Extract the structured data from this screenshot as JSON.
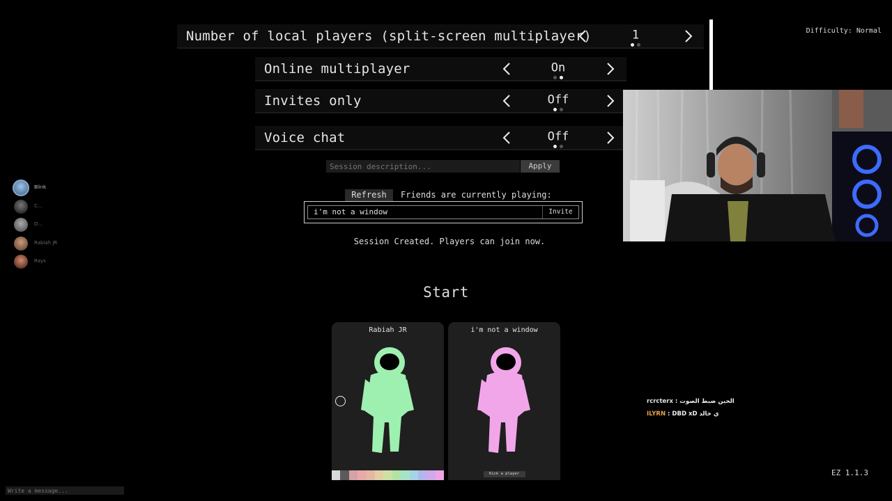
{
  "settings": {
    "local_players": {
      "label": "Number of local players (split-screen multiplayer)",
      "value": "1"
    },
    "online": {
      "label": "Online multiplayer",
      "value": "On"
    },
    "invites": {
      "label": "Invites only",
      "value": "Off"
    },
    "voice": {
      "label": "Voice chat",
      "value": "Off"
    }
  },
  "difficulty": "Difficulty: Normal",
  "session": {
    "description_placeholder": "Session description...",
    "apply_label": "Apply",
    "refresh_label": "Refresh",
    "friends_playing_label": "Friends are currently playing:",
    "friend_entry": {
      "name": "i'm not a window",
      "invite_label": "Invite"
    },
    "status": "Session Created. Players can join now."
  },
  "start_label": "Start",
  "players": [
    {
      "name": "Rabiah JR",
      "suit_color": "#9ef0b0"
    },
    {
      "name": "i'm not a window",
      "suit_color": "#f2a6ea",
      "kick_label": "Kick a player"
    }
  ],
  "swatch_colors": [
    "#d9d9d9",
    "#5b5b5b",
    "#d6a1a7",
    "#e8aaa9",
    "#e4b8a2",
    "#e2cfa4",
    "#cfe0a4",
    "#b1e3a7",
    "#a7e3c8",
    "#a7d3e6",
    "#b3b6ec",
    "#cfa9ea",
    "#eea5e5"
  ],
  "friends_list": [
    {
      "name": "Blink"
    },
    {
      "name": "C..."
    },
    {
      "name": "D..."
    },
    {
      "name": "Rabiah JR"
    },
    {
      "name": "Rays"
    }
  ],
  "chat": [
    {
      "user": "rcrcterx",
      "text": "الحين ضبط الصوت"
    },
    {
      "user": "ILYRN",
      "text": "DBD xD ي خالد"
    }
  ],
  "version": "EZ 1.1.3",
  "message_placeholder": "Write a message..."
}
